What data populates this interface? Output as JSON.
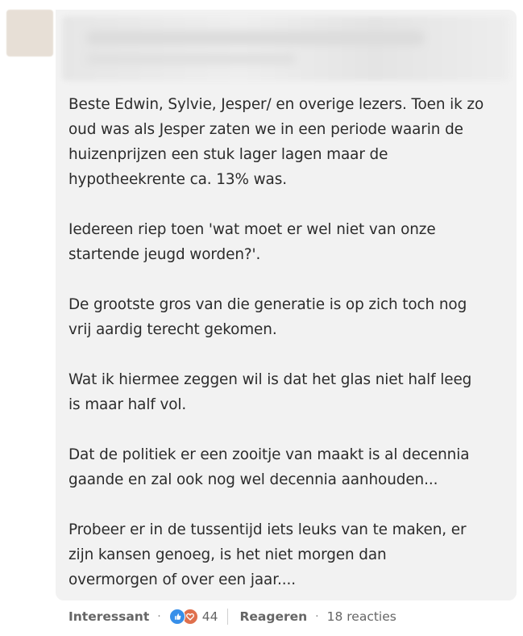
{
  "comment": {
    "paragraphs": [
      "Beste Edwin, Sylvie, Jesper/ en overige lezers. Toen ik zo\noud was als Jesper zaten we in een periode waarin de\nhuizenprijzen een stuk lager lagen maar de\nhypotheekrente ca. 13% was.",
      "Iedereen riep toen 'wat moet er wel niet van onze\nstartende jeugd worden?'.",
      "De grootste gros van die generatie is op zich toch nog\nvrij aardig terecht gekomen.",
      "Wat ik hiermee zeggen wil is dat het glas niet half leeg\nis maar half vol.",
      "Dat de politiek er een zooitje van maakt is al decennia\ngaande en zal ook nog wel decennia aanhouden...",
      "Probeer er in de tussentijd iets leuks van te maken, er\nzijn kansen genoeg, is het niet morgen dan\novermorgen of over een jaar...."
    ]
  },
  "actions": {
    "reaction_label": "Interessant",
    "reaction_count": "44",
    "reply_label": "Reageren",
    "reply_count": "18 reacties",
    "separator": "·"
  },
  "icons": {
    "like": "like-icon",
    "love": "love-icon"
  },
  "colors": {
    "bubble_bg": "#f2f2f2",
    "text": "#2b2b2b",
    "muted": "#666666",
    "like": "#378fe9",
    "love": "#df704d"
  }
}
